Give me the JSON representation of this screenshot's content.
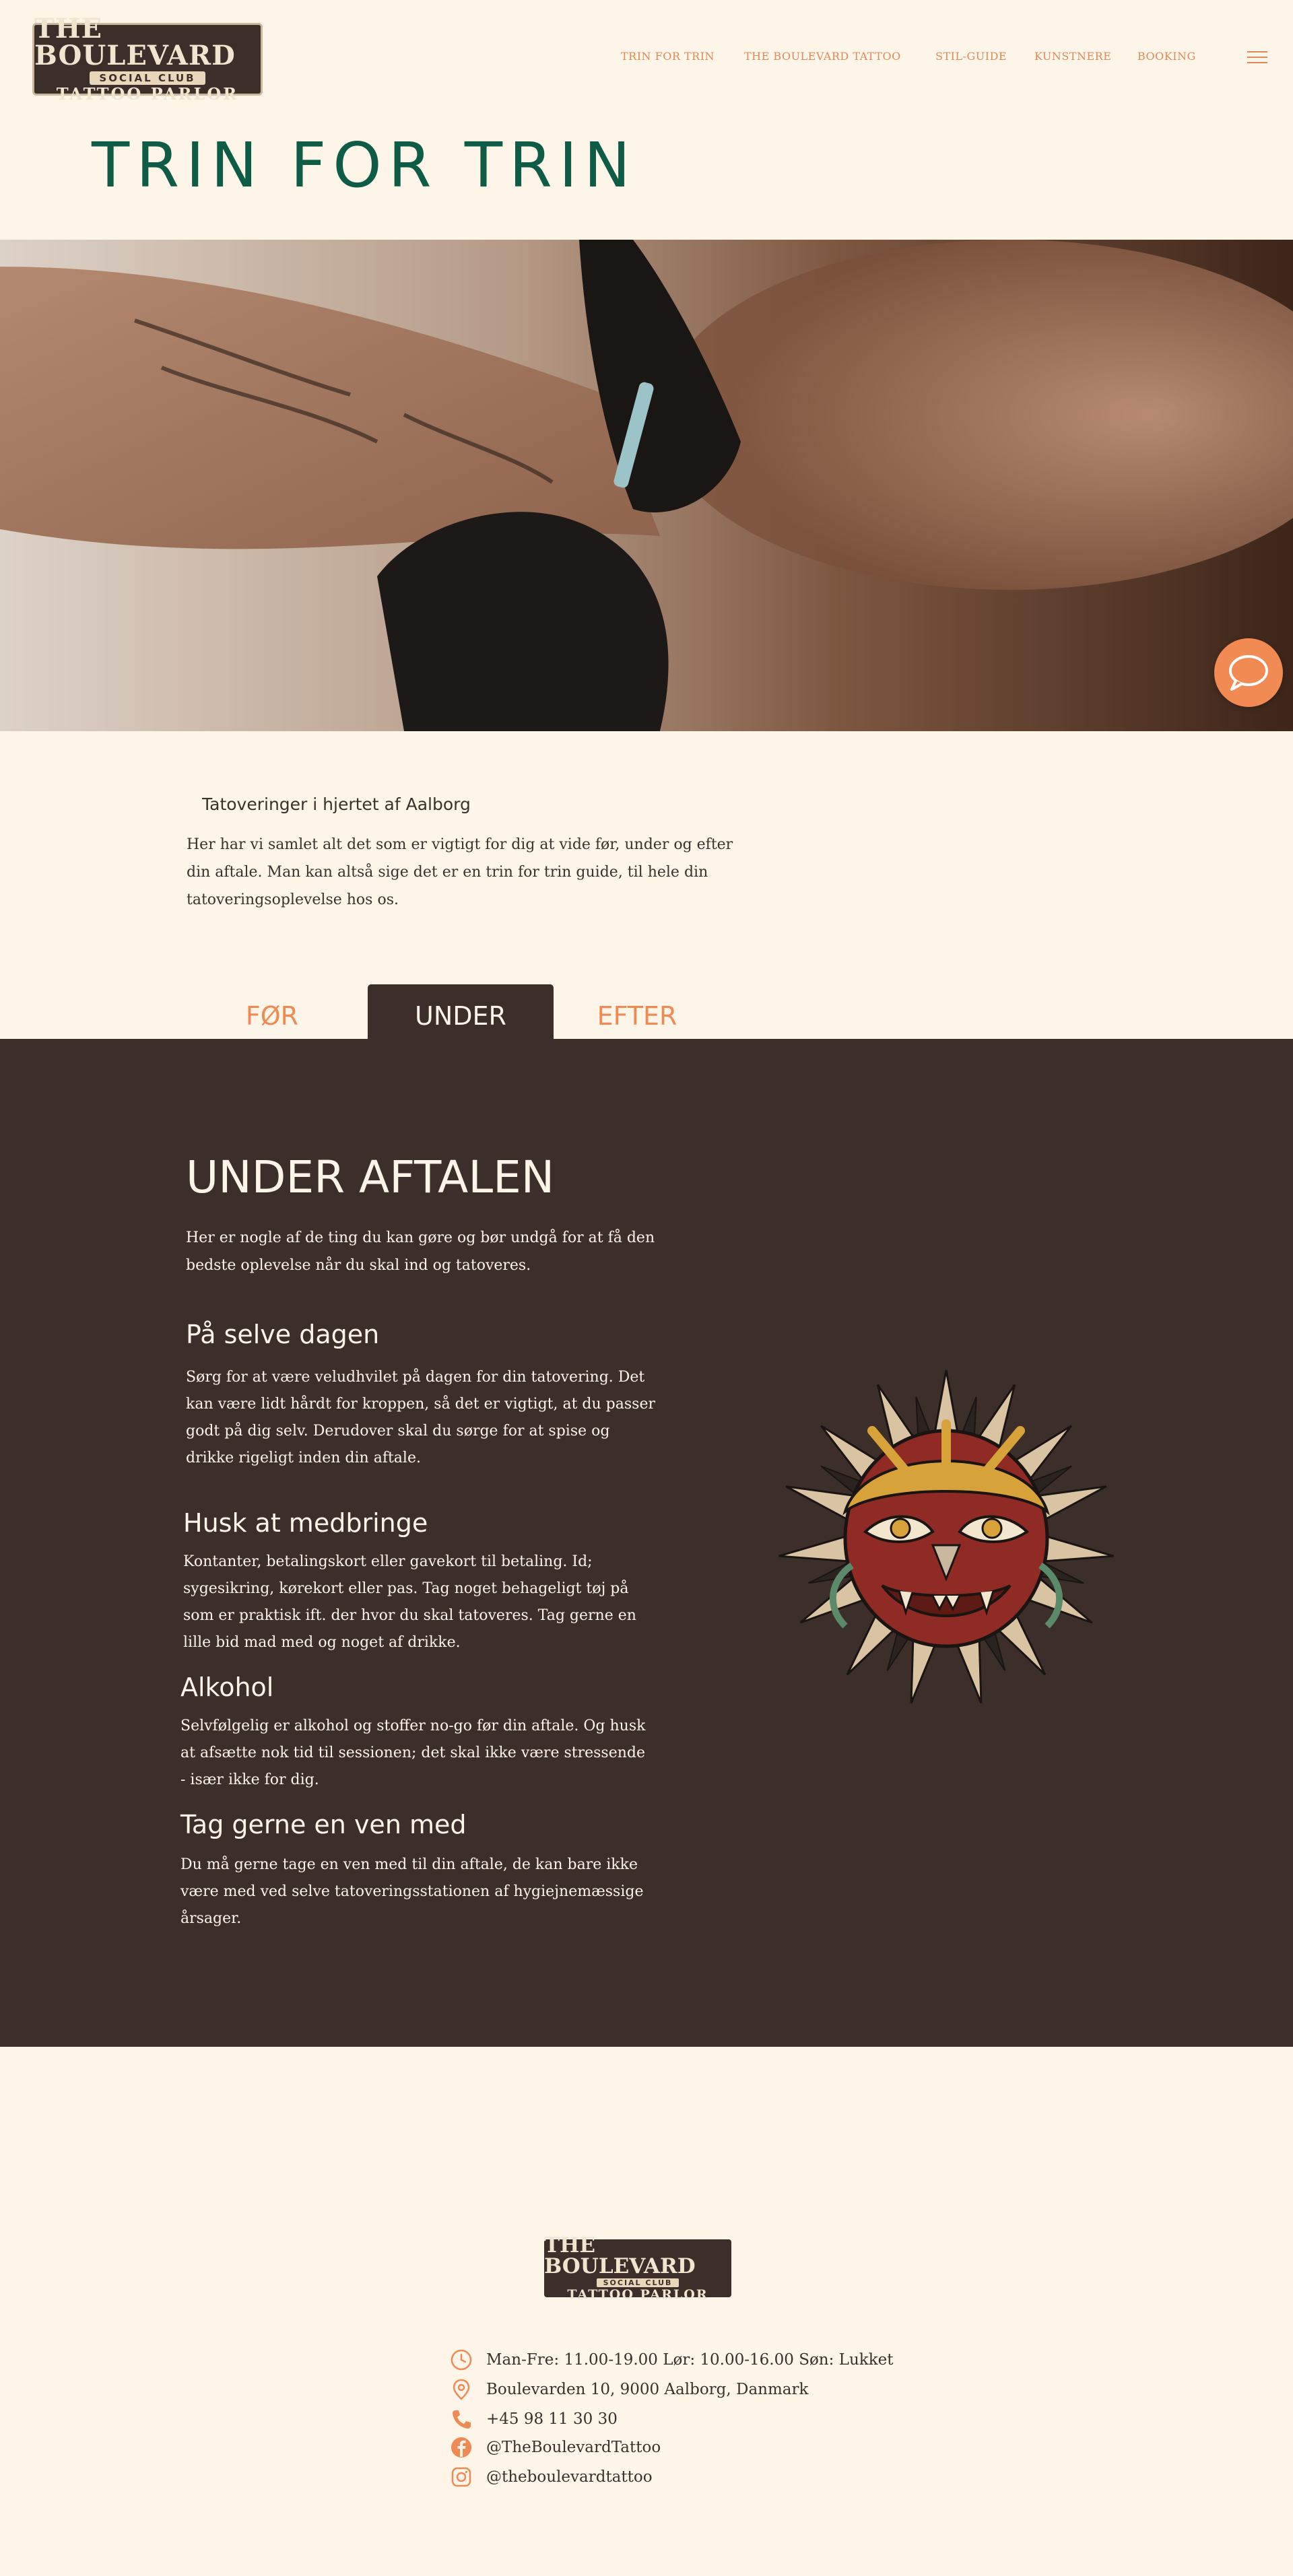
{
  "logo": {
    "line1": "THE BOULEVARD",
    "line2": "SOCIAL CLUB",
    "line3": "TATTOO PARLOR"
  },
  "nav": {
    "items": [
      "TRIN FOR TRIN",
      "THE BOULEVARD TATTOO",
      "STIL-GUIDE",
      "KUNSTNERE",
      "BOOKING"
    ],
    "menu_icon": "hamburger-icon"
  },
  "page_title": "TRIN FOR TRIN",
  "intro": {
    "subtitle": "Tatoveringer i hjertet af Aalborg",
    "text": "Her har vi samlet alt det som er vigtigt for dig at vide før, under og efter din aftale. Man kan altså sige det er en trin for trin guide, til hele din tatoveringsoplevelse hos os."
  },
  "tabs": [
    "FØR",
    "UNDER",
    "EFTER"
  ],
  "section": {
    "title": "UNDER AFTALEN",
    "intro": "Her er nogle af de ting du kan gøre og bør undgå for at få den bedste oplevelse når du skal ind og tatoveres.",
    "blocks": [
      {
        "heading": "På selve dagen",
        "text": "Sørg for at være veludhvilet på dagen for din tatovering. Det kan være lidt hårdt for kroppen, så det er vigtigt, at du passer godt på dig selv. Derudover skal du sørge for at spise og drikke rigeligt inden din aftale."
      },
      {
        "heading": "Husk at medbringe",
        "text": "Kontanter, betalingskort eller gavekort til betaling. Id; sygesikring, kørekort eller pas. Tag noget behageligt tøj på som er praktisk ift. der hvor du skal tatoveres. Tag gerne en lille bid mad med og noget af drikke."
      },
      {
        "heading": "Alkohol",
        "text": "Selvfølgelig er alkohol og stoffer no-go før din aftale. Og husk at afsætte nok tid til sessionen; det skal ikke være stressende - især ikke for dig."
      },
      {
        "heading": "Tag gerne en ven med",
        "text": "Du må gerne tage en ven med til din aftale, de kan bare ikke være med ved selve tatoveringsstationen af hygiejnemæssige årsager."
      }
    ]
  },
  "footer": {
    "hours": "Man-Fre: 11.00-19.00 Lør: 10.00-16.00 Søn: Lukket",
    "address": "Boulevarden 10, 9000 Aalborg, Danmark",
    "phone": "+45 98 11 30 30",
    "facebook": "@TheBoulevardTattoo",
    "instagram": "@theboulevardtattoo"
  },
  "colors": {
    "background": "#fdf5e8",
    "accent": "#f08a55",
    "title_green": "#0f5c46",
    "dark": "#3c2f2a"
  }
}
